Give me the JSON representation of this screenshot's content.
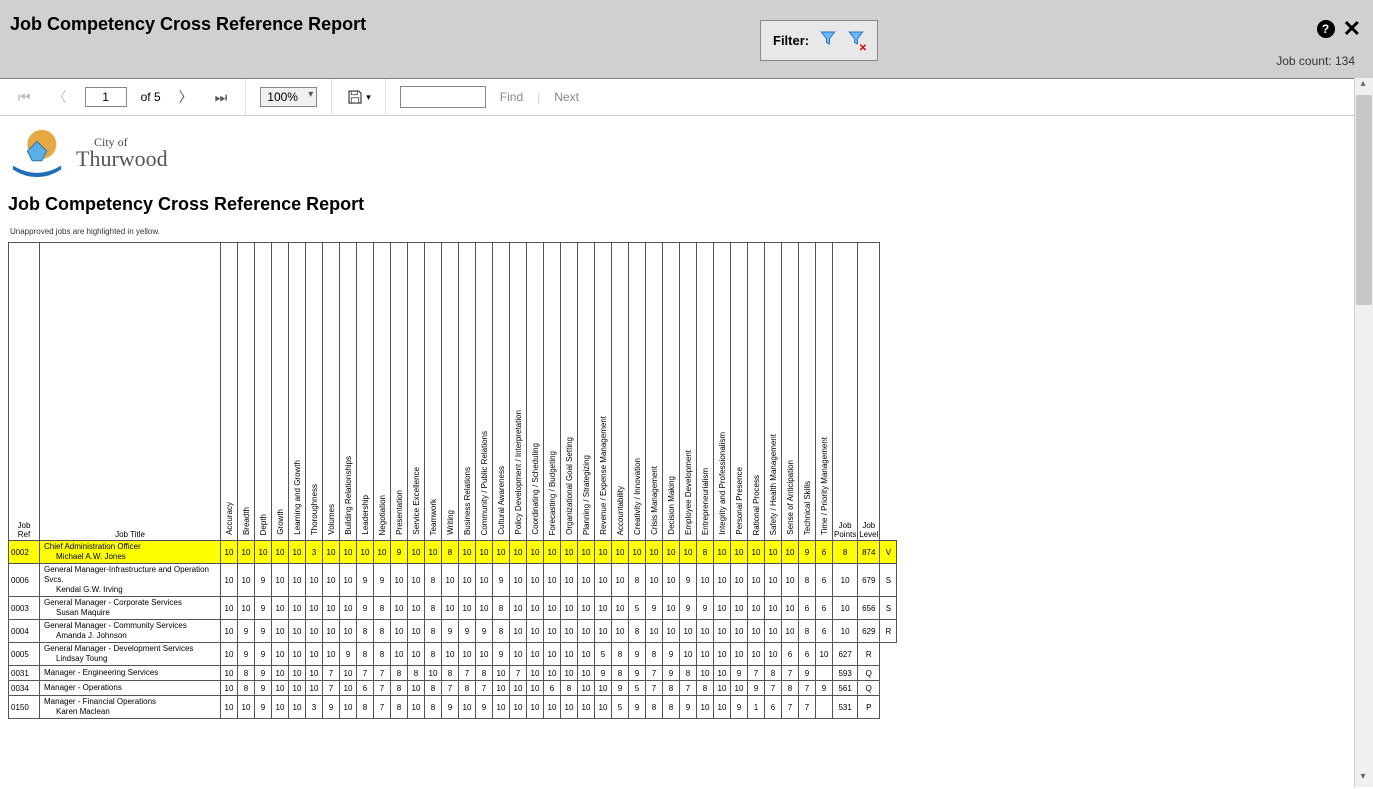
{
  "header": {
    "title": "Job Competency Cross Reference Report",
    "filter_label": "Filter:",
    "job_count_label": "Job count:",
    "job_count_value": "134"
  },
  "toolbar": {
    "page_value": "1",
    "of_label": "of",
    "total_pages": "5",
    "zoom": "100%",
    "find_label": "Find",
    "next_label": "Next"
  },
  "report": {
    "city_line1": "City of",
    "city_line2": "Thurwood",
    "report_title": "Job Competency Cross Reference Report",
    "note": "Unapproved jobs are highlighted in yellow."
  },
  "columns": {
    "job_ref": "Job Ref",
    "job_title": "Job Title",
    "comp": [
      "Accuracy",
      "Breadth",
      "Depth",
      "Growth",
      "Learning and Growth",
      "Thoroughness",
      "Volumes",
      "Building Relationships",
      "Leadership",
      "Negotiation",
      "Presentation",
      "Service Excellence",
      "Teamwork",
      "Writing",
      "Business Relations",
      "Community / Public Relations",
      "Cultural Awareness",
      "Policy Development / Interpretation",
      "Coordinating / Scheduling",
      "Forecasting / Budgeting",
      "Organizational Goal Setting",
      "Planning / Strategizing",
      "Revenue / Expense Management",
      "Accountability",
      "Creativity / Innovation",
      "Crisis Management",
      "Decision Making",
      "Employee Development",
      "Entrepreneurialism",
      "Integrity and Professionalism",
      "Personal Presence",
      "Rational Process",
      "Safety / Health Management",
      "Sense of Anticipation",
      "Technical Skills",
      "Time / Priority Management"
    ],
    "points": "Job Points",
    "level": "Job Level"
  },
  "rows": [
    {
      "ref": "0002",
      "title": "Chief Administration Officer",
      "name": "Michael A.W. Jones",
      "hl": true,
      "v": [
        "10",
        "10",
        "10",
        "10",
        "10",
        "3",
        "10",
        "10",
        "10",
        "10",
        "9",
        "10",
        "10",
        "8",
        "10",
        "10",
        "10",
        "10",
        "10",
        "10",
        "10",
        "10",
        "10",
        "10",
        "10",
        "10",
        "10",
        "10",
        "8",
        "10",
        "10",
        "10",
        "10",
        "10",
        "9",
        "6",
        "8"
      ],
      "pts": "874",
      "lvl": "V"
    },
    {
      "ref": "0006",
      "title": "General Manager-Infrastructure and Operation Svcs.",
      "name": "Kendal G.W. Irving",
      "hl": false,
      "v": [
        "10",
        "10",
        "9",
        "10",
        "10",
        "10",
        "10",
        "10",
        "9",
        "9",
        "10",
        "10",
        "8",
        "10",
        "10",
        "10",
        "9",
        "10",
        "10",
        "10",
        "10",
        "10",
        "10",
        "10",
        "8",
        "10",
        "10",
        "9",
        "10",
        "10",
        "10",
        "10",
        "10",
        "10",
        "8",
        "6",
        "10"
      ],
      "pts": "679",
      "lvl": "S"
    },
    {
      "ref": "0003",
      "title": "General Manager - Corporate Services",
      "name": "Susan Maquire",
      "hl": false,
      "v": [
        "10",
        "10",
        "9",
        "10",
        "10",
        "10",
        "10",
        "10",
        "9",
        "8",
        "10",
        "10",
        "8",
        "10",
        "10",
        "10",
        "8",
        "10",
        "10",
        "10",
        "10",
        "10",
        "10",
        "10",
        "5",
        "9",
        "10",
        "9",
        "9",
        "10",
        "10",
        "10",
        "10",
        "10",
        "6",
        "6",
        "10"
      ],
      "pts": "656",
      "lvl": "S"
    },
    {
      "ref": "0004",
      "title": "General Manager - Community Services",
      "name": "Amanda J. Johnson",
      "hl": false,
      "v": [
        "10",
        "9",
        "9",
        "10",
        "10",
        "10",
        "10",
        "10",
        "8",
        "8",
        "10",
        "10",
        "8",
        "9",
        "9",
        "9",
        "8",
        "10",
        "10",
        "10",
        "10",
        "10",
        "10",
        "10",
        "8",
        "10",
        "10",
        "10",
        "10",
        "10",
        "10",
        "10",
        "10",
        "10",
        "8",
        "6",
        "10"
      ],
      "pts": "629",
      "lvl": "R"
    },
    {
      "ref": "0005",
      "title": "General Manager - Development Services",
      "name": "Lindsay Toung",
      "hl": false,
      "v": [
        "10",
        "9",
        "9",
        "10",
        "10",
        "10",
        "10",
        "9",
        "8",
        "8",
        "10",
        "10",
        "8",
        "10",
        "10",
        "10",
        "9",
        "10",
        "10",
        "10",
        "10",
        "10",
        "5",
        "8",
        "9",
        "8",
        "9",
        "10",
        "10",
        "10",
        "10",
        "10",
        "10",
        "6",
        "6",
        "10"
      ],
      "pts": "627",
      "lvl": "R"
    },
    {
      "ref": "0031",
      "title": "Manager - Engineering Services",
      "name": "",
      "hl": false,
      "v": [
        "10",
        "8",
        "9",
        "10",
        "10",
        "10",
        "7",
        "10",
        "7",
        "7",
        "8",
        "8",
        "10",
        "8",
        "7",
        "8",
        "10",
        "7",
        "10",
        "10",
        "10",
        "10",
        "9",
        "8",
        "9",
        "7",
        "9",
        "8",
        "10",
        "10",
        "9",
        "7",
        "8",
        "7",
        "9"
      ],
      "pts": "593",
      "lvl": "Q"
    },
    {
      "ref": "0034",
      "title": "Manager - Operations",
      "name": "",
      "hl": false,
      "v": [
        "10",
        "8",
        "9",
        "10",
        "10",
        "10",
        "7",
        "10",
        "6",
        "7",
        "8",
        "10",
        "8",
        "7",
        "8",
        "7",
        "10",
        "10",
        "10",
        "6",
        "8",
        "10",
        "10",
        "9",
        "5",
        "7",
        "8",
        "7",
        "8",
        "10",
        "10",
        "9",
        "7",
        "8",
        "7",
        "9"
      ],
      "pts": "561",
      "lvl": "Q"
    },
    {
      "ref": "0150",
      "title": "Manager - Financial Operations",
      "name": "Karen Maclean",
      "hl": false,
      "v": [
        "10",
        "10",
        "9",
        "10",
        "10",
        "3",
        "9",
        "10",
        "8",
        "7",
        "8",
        "10",
        "8",
        "9",
        "10",
        "9",
        "10",
        "10",
        "10",
        "10",
        "10",
        "10",
        "10",
        "5",
        "9",
        "8",
        "8",
        "9",
        "10",
        "10",
        "9",
        "1",
        "6",
        "7",
        "7"
      ],
      "pts": "531",
      "lvl": "P"
    }
  ]
}
